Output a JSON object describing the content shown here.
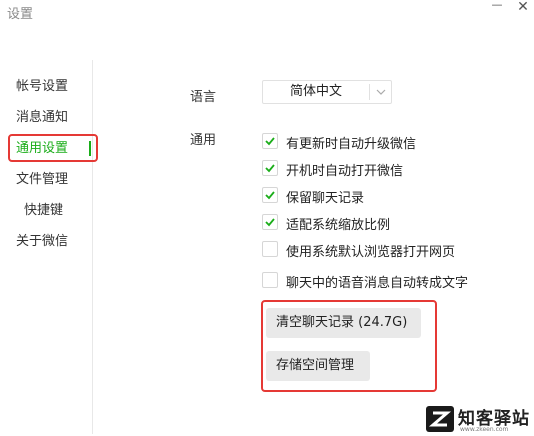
{
  "window": {
    "title": "设置",
    "minimize_glyph": "—",
    "close_glyph": "✕"
  },
  "sidebar": {
    "items": [
      {
        "label": "帐号设置"
      },
      {
        "label": "消息通知"
      },
      {
        "label": "通用设置"
      },
      {
        "label": "文件管理"
      },
      {
        "label": "快捷键"
      },
      {
        "label": "关于微信"
      }
    ],
    "active_index": 2
  },
  "settings": {
    "language_label": "语言",
    "language_value": "简体中文",
    "general_label": "通用",
    "options": [
      {
        "label": "有更新时自动升级微信",
        "checked": true
      },
      {
        "label": "开机时自动打开微信",
        "checked": true
      },
      {
        "label": "保留聊天记录",
        "checked": true
      },
      {
        "label": "适配系统缩放比例",
        "checked": true
      },
      {
        "label": "使用系统默认浏览器打开网页",
        "checked": false
      },
      {
        "label": "聊天中的语音消息自动转成文字",
        "checked": false
      }
    ],
    "clear_chat_button": "清空聊天记录 (24.7G)",
    "storage_button": "存储空间管理"
  },
  "watermark": {
    "brand": "知客驿站",
    "url": "www.zkeen.com"
  },
  "colors": {
    "accent": "#1aad19",
    "highlight_box": "#e53935",
    "button_bg": "#e9e9e9"
  }
}
